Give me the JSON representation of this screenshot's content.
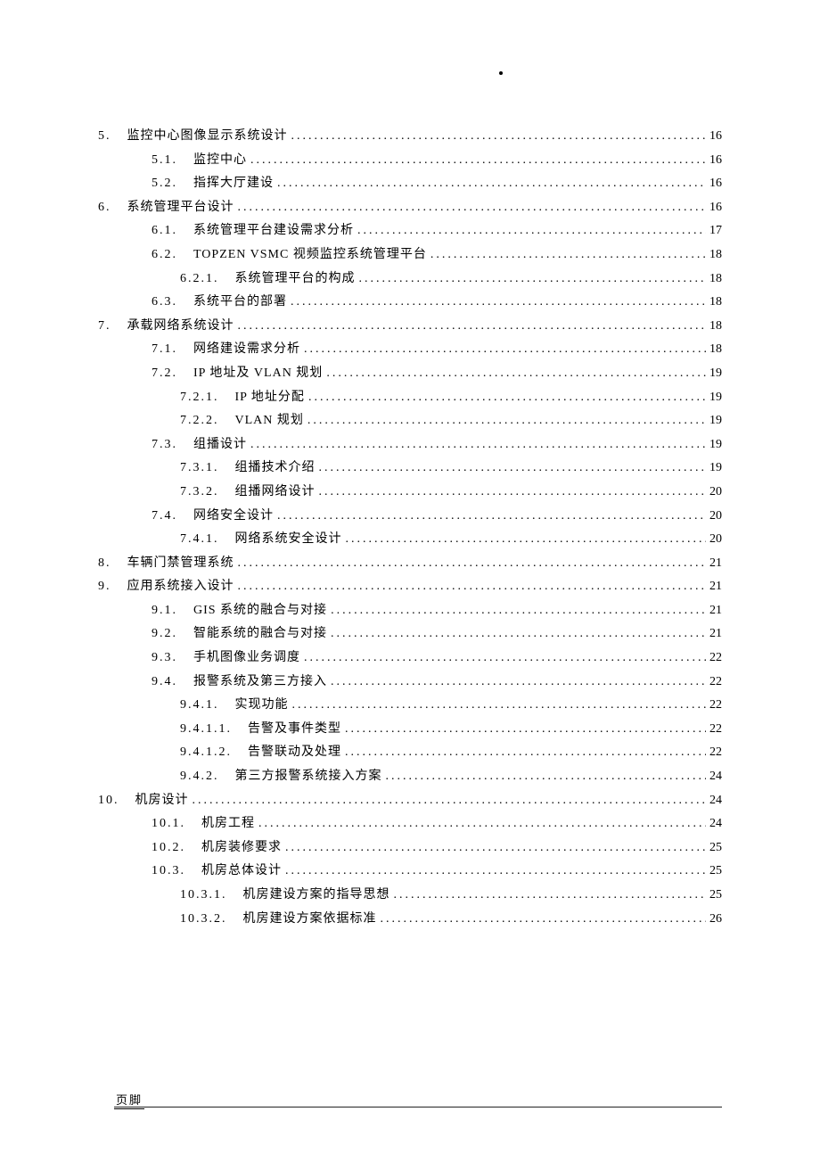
{
  "footer": "页脚",
  "leader": ".........................................................................................................................................................",
  "toc": [
    {
      "num": "5.",
      "title": "监控中心图像显示系统设计",
      "page": "16",
      "level": 1
    },
    {
      "num": "5.1.",
      "title": "监控中心",
      "page": "16",
      "level": 2
    },
    {
      "num": "5.2.",
      "title": "指挥大厅建设",
      "page": "16",
      "level": 2
    },
    {
      "num": "6.",
      "title": "系统管理平台设计",
      "page": "16",
      "level": 1
    },
    {
      "num": "6.1.",
      "title": "系统管理平台建设需求分析",
      "page": "17",
      "level": 2
    },
    {
      "num": "6.2.",
      "title": "TOPZEN VSMC 视频监控系统管理平台",
      "page": "18",
      "level": 2
    },
    {
      "num": "6.2.1.",
      "title": "系统管理平台的构成",
      "page": "18",
      "level": 3
    },
    {
      "num": "6.3.",
      "title": "系统平台的部署",
      "page": "18",
      "level": 2
    },
    {
      "num": "7.",
      "title": "承载网络系统设计",
      "page": "18",
      "level": 1
    },
    {
      "num": "7.1.",
      "title": "网络建设需求分析",
      "page": "18",
      "level": 2
    },
    {
      "num": "7.2.",
      "title": "IP 地址及 VLAN 规划",
      "page": "19",
      "level": 2
    },
    {
      "num": "7.2.1.",
      "title": "IP 地址分配",
      "page": "19",
      "level": 3
    },
    {
      "num": "7.2.2.",
      "title": "VLAN 规划",
      "page": "19",
      "level": 3
    },
    {
      "num": "7.3.",
      "title": "组播设计",
      "page": "19",
      "level": 2
    },
    {
      "num": "7.3.1.",
      "title": "组播技术介绍",
      "page": "19",
      "level": 3
    },
    {
      "num": "7.3.2.",
      "title": "组播网络设计",
      "page": "20",
      "level": 3
    },
    {
      "num": "7.4.",
      "title": "网络安全设计",
      "page": "20",
      "level": 2
    },
    {
      "num": "7.4.1.",
      "title": "网络系统安全设计",
      "page": "20",
      "level": 3
    },
    {
      "num": "8.",
      "title": "车辆门禁管理系统",
      "page": "21",
      "level": 1
    },
    {
      "num": "9.",
      "title": "应用系统接入设计",
      "page": "21",
      "level": 1
    },
    {
      "num": "9.1.",
      "title": "GIS 系统的融合与对接",
      "page": "21",
      "level": 2
    },
    {
      "num": "9.2.",
      "title": "智能系统的融合与对接",
      "page": "21",
      "level": 2
    },
    {
      "num": "9.3.",
      "title": "手机图像业务调度",
      "page": "22",
      "level": 2
    },
    {
      "num": "9.4.",
      "title": "报警系统及第三方接入",
      "page": "22",
      "level": 2
    },
    {
      "num": "9.4.1.",
      "title": "实现功能",
      "page": "22",
      "level": 3
    },
    {
      "num": "9.4.1.1.",
      "title": "告警及事件类型",
      "page": "22",
      "level": 4
    },
    {
      "num": "9.4.1.2.",
      "title": "告警联动及处理",
      "page": "22",
      "level": 4
    },
    {
      "num": "9.4.2.",
      "title": "第三方报警系统接入方案",
      "page": "24",
      "level": 3
    },
    {
      "num": "10.",
      "title": "机房设计",
      "page": "24",
      "level": 1
    },
    {
      "num": "10.1.",
      "title": "机房工程",
      "page": "24",
      "level": 2
    },
    {
      "num": "10.2.",
      "title": "机房装修要求",
      "page": "25",
      "level": 2
    },
    {
      "num": "10.3.",
      "title": "机房总体设计",
      "page": "25",
      "level": 2
    },
    {
      "num": "10.3.1.",
      "title": "机房建设方案的指导思想",
      "page": "25",
      "level": 3
    },
    {
      "num": "10.3.2.",
      "title": "机房建设方案依据标准",
      "page": "26",
      "level": 3
    }
  ]
}
